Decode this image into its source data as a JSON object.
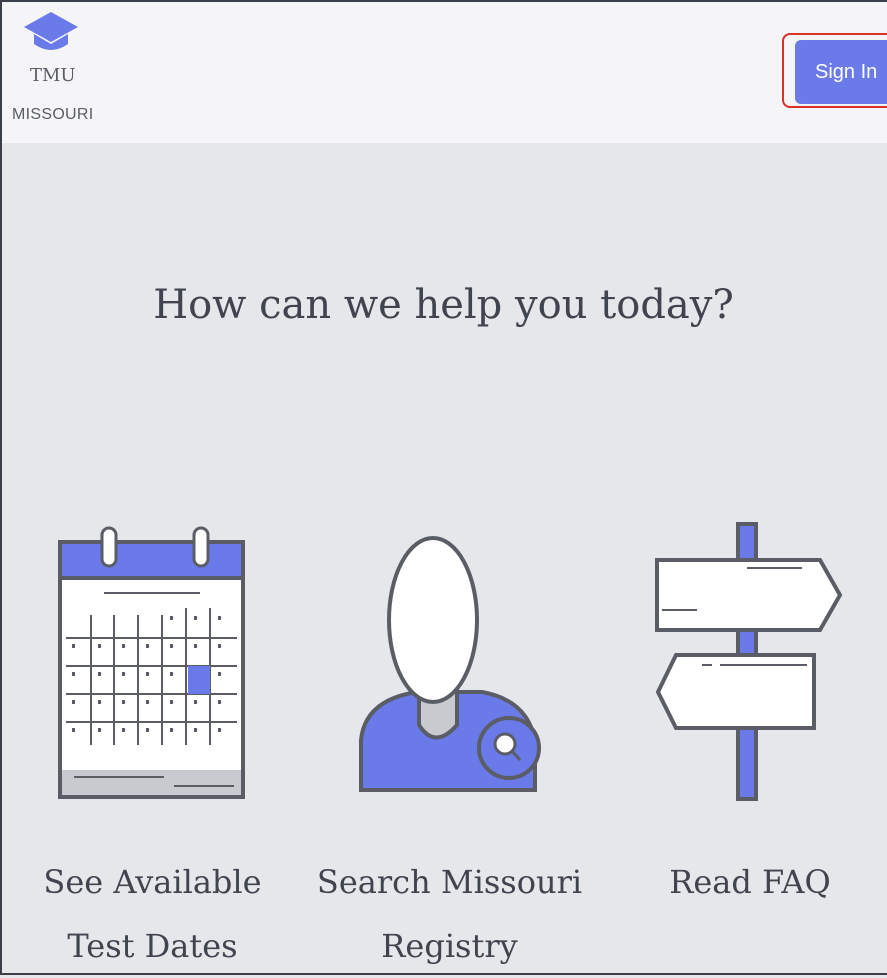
{
  "header": {
    "logo_line1": "TMU",
    "logo_line2": "MISSOURI",
    "signin_label": "Sign In"
  },
  "main": {
    "headline": "How can we help you today?",
    "options": [
      {
        "label": "See Available Test Dates",
        "icon": "calendar-icon"
      },
      {
        "label": "Search Missouri Registry",
        "icon": "person-search-icon"
      },
      {
        "label": "Read FAQ",
        "icon": "signpost-icon"
      }
    ]
  },
  "colors": {
    "accent": "#6a7ae8",
    "outline": "#5a5d66",
    "highlight_border": "#d8302a",
    "background": "#e6e7eb",
    "header_bg": "#f5f5f7"
  }
}
